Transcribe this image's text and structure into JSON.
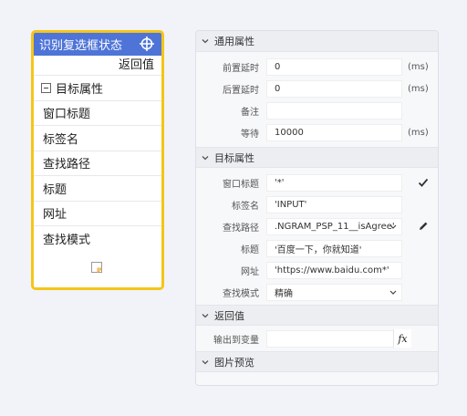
{
  "node": {
    "title": "识别复选框状态",
    "icon": "crosshair-icon",
    "return_label": "返回值",
    "group_label": "目标属性",
    "rows": [
      "窗口标题",
      "标签名",
      "查找路径",
      "标题",
      "网址",
      "查找模式"
    ],
    "note_icon": "note-icon",
    "colors": {
      "header": "#4e74d8",
      "border": "#f5c518"
    }
  },
  "panel": {
    "general": {
      "header": "通用属性",
      "pre_delay_label": "前置延时",
      "pre_delay_value": "0",
      "post_delay_label": "后置延时",
      "post_delay_value": "0",
      "remark_label": "备注",
      "remark_value": "",
      "wait_label": "等待",
      "wait_value": "10000",
      "unit": "(ms)"
    },
    "target": {
      "header": "目标属性",
      "window_title_label": "窗口标题",
      "window_title_value": "'*'",
      "tag_label": "标签名",
      "tag_value": "'INPUT'",
      "path_label": "查找路径",
      "path_value": ".NGRAM_PSP_11__isAgree'",
      "title_label": "标题",
      "title_value": "'百度一下，你就知道'",
      "url_label": "网址",
      "url_value": "'https://www.baidu.com*'",
      "mode_label": "查找模式",
      "mode_value": "精确"
    },
    "returns": {
      "header": "返回值",
      "output_label": "输出到变量",
      "output_value": "",
      "fx_label": "fx"
    },
    "preview": {
      "header": "图片预览"
    }
  }
}
